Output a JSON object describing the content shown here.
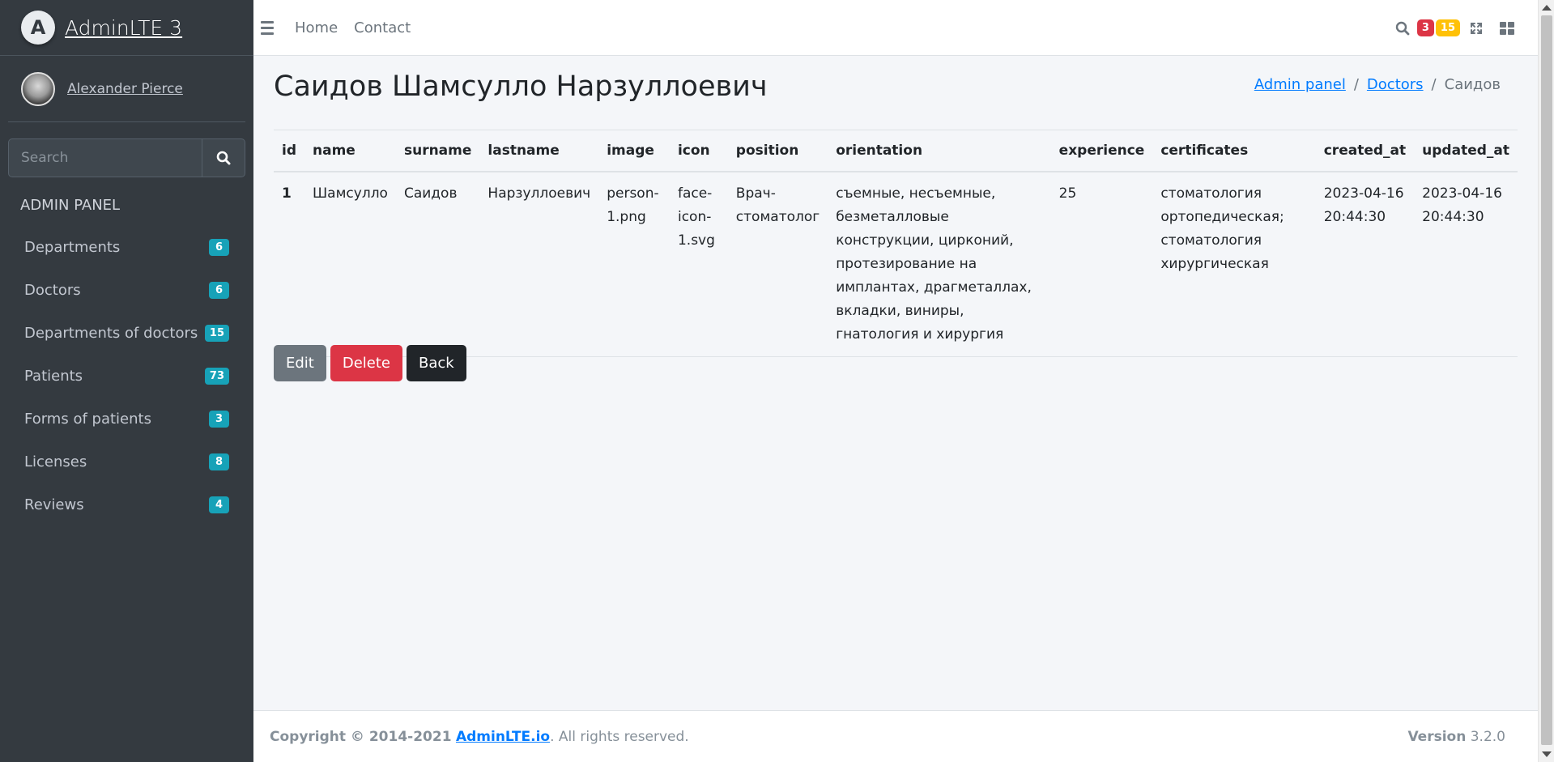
{
  "brand": {
    "logo_letter": "A",
    "title": "AdminLTE 3"
  },
  "user": {
    "name": "Alexander Pierce"
  },
  "sidebar": {
    "search_placeholder": "Search",
    "header": "ADMIN PANEL",
    "items": [
      {
        "label": "Departments",
        "badge": "6"
      },
      {
        "label": "Doctors",
        "badge": "6"
      },
      {
        "label": "Departments of doctors",
        "badge": "15"
      },
      {
        "label": "Patients",
        "badge": "73"
      },
      {
        "label": "Forms of patients",
        "badge": "3"
      },
      {
        "label": "Licenses",
        "badge": "8"
      },
      {
        "label": "Reviews",
        "badge": "4"
      }
    ]
  },
  "topbar": {
    "links": [
      "Home",
      "Contact"
    ],
    "badge_messages": "3",
    "badge_notifications": "15"
  },
  "page": {
    "title": "Саидов Шамсулло Нарзуллоевич",
    "breadcrumb": [
      "Admin panel",
      "Doctors",
      "Саидов"
    ]
  },
  "table": {
    "columns": [
      "id",
      "name",
      "surname",
      "lastname",
      "image",
      "icon",
      "position",
      "orientation",
      "experience",
      "certificates",
      "created_at",
      "updated_at"
    ],
    "row": {
      "id": "1",
      "name": "Шамсулло",
      "surname": "Саидов",
      "lastname": "Нарзуллоевич",
      "image": "person-1.png",
      "icon": "face-icon-1.svg",
      "position": "Врач-стоматолог",
      "orientation": "съемные, несъемные, безметалловые конструкции, цирконий, протезирование на имплантах, драгметаллах, вкладки, виниры, гнатология и хирургия",
      "experience": "25",
      "certificates": "стоматология ортопедическая; стоматология хирургическая",
      "created_at": "2023-04-16 20:44:30",
      "updated_at": "2023-04-16 20:44:30"
    }
  },
  "actions": {
    "edit": "Edit",
    "delete": "Delete",
    "back": "Back"
  },
  "footer": {
    "copyright": "Copyright © 2014-2021",
    "link": "AdminLTE.io",
    "rights": ". All rights reserved.",
    "version_label": "Version",
    "version": "3.2.0"
  },
  "colors": {
    "sidebar": "#343a40",
    "info_badge": "#17a2b8",
    "danger": "#dc3545",
    "warning": "#ffc107",
    "link": "#007bff"
  }
}
